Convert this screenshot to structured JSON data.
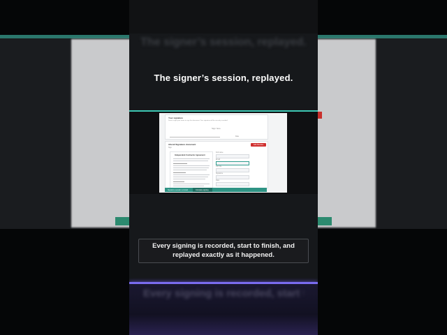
{
  "video": {
    "heading": "The signer’s session, replayed.",
    "caption": "Every signing is recorded, start to finish, and replayed exactly as it happened."
  },
  "doc": {
    "sig_title": "Your signature",
    "sig_sub": "Draw or type your name to sign this document. Your signature will be securely recorded.",
    "sig_placeholder": "Sign here",
    "sig_date_label": "Date",
    "main_title": "Attend Signature document",
    "main_sub": "Sign",
    "red_button": "Add Attendee Signers",
    "agreement_title": "Independent Contractor Agreement",
    "fields": [
      "Full name",
      "Email",
      "Job title",
      "Signature",
      "Date"
    ],
    "bottom_left": "Signature session recorded",
    "bottom_button": "Complete signing"
  },
  "colors": {
    "accent_teal": "#3ec8b4",
    "accent_purple": "#7a6cf0",
    "danger_red": "#d0302f",
    "brand_green": "#2f9384"
  }
}
